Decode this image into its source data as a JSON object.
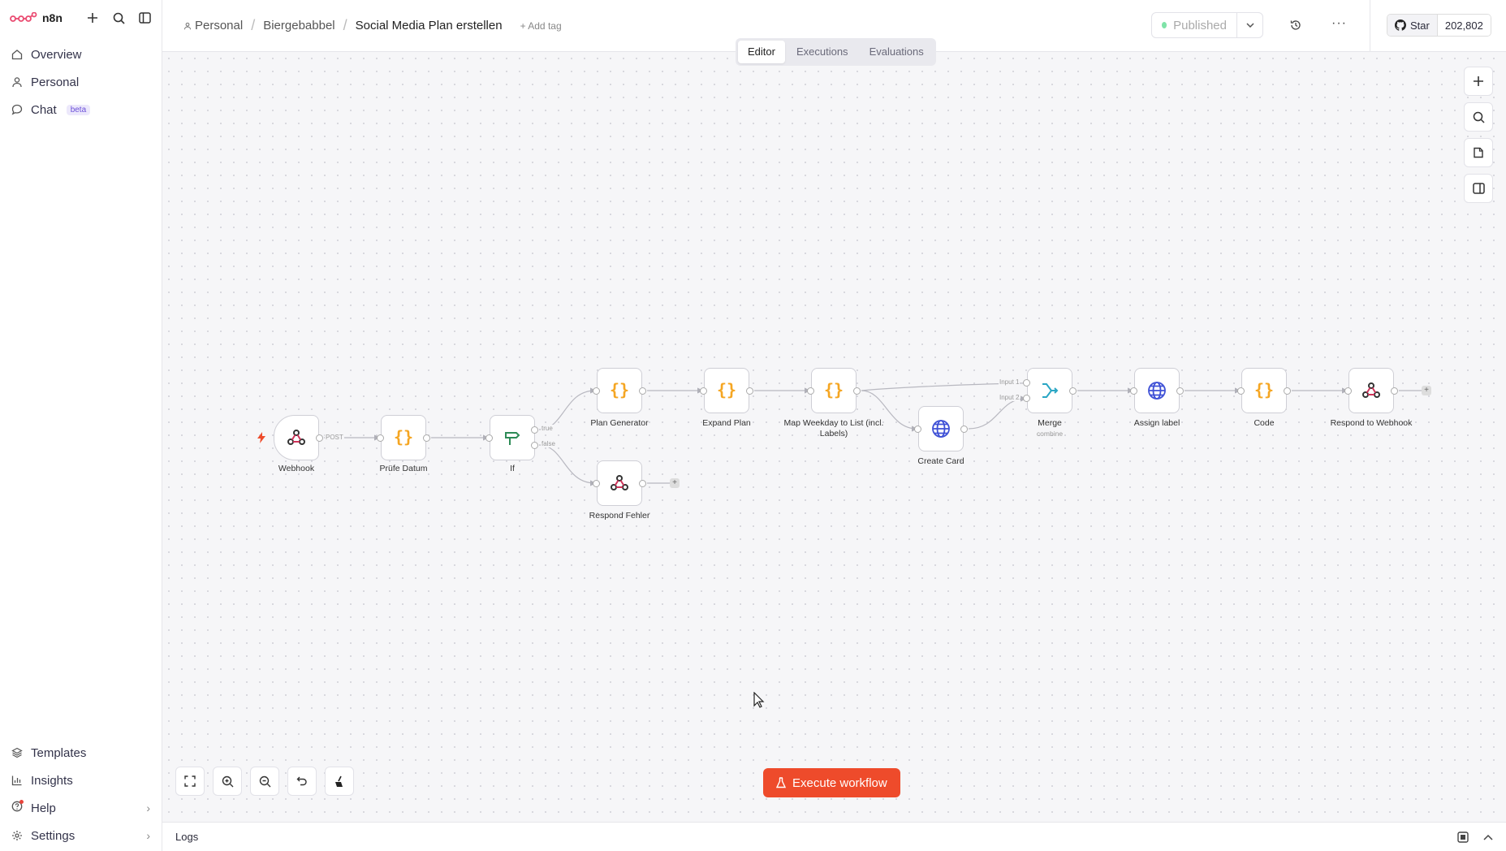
{
  "app": {
    "logo_text": "n8n"
  },
  "sidebar": {
    "items": [
      {
        "label": "Overview",
        "icon": "home-icon"
      },
      {
        "label": "Personal",
        "icon": "user-icon"
      },
      {
        "label": "Chat",
        "icon": "chat-icon",
        "badge": "beta"
      }
    ],
    "bottom_items": [
      {
        "label": "Templates",
        "icon": "templates-icon"
      },
      {
        "label": "Insights",
        "icon": "insights-icon"
      },
      {
        "label": "Help",
        "icon": "help-icon",
        "has_chevron": true
      },
      {
        "label": "Settings",
        "icon": "gear-icon",
        "has_chevron": true
      }
    ]
  },
  "header": {
    "breadcrumbs": [
      "Personal",
      "Biergebabbel",
      "Social Media Plan erstellen"
    ],
    "add_tag": "+ Add tag",
    "status": "Published",
    "github_star": "Star",
    "github_count": "202,802"
  },
  "tabs": [
    {
      "label": "Editor",
      "active": true
    },
    {
      "label": "Executions",
      "active": false
    },
    {
      "label": "Evaluations",
      "active": false
    }
  ],
  "workflow": {
    "nodes": [
      {
        "id": "webhook",
        "label": "Webhook",
        "icon": "webhook-icon"
      },
      {
        "id": "pruefe",
        "label": "Prüfe Datum",
        "icon": "code-braces-icon"
      },
      {
        "id": "if",
        "label": "If",
        "icon": "if-signpost-icon"
      },
      {
        "id": "plan",
        "label": "Plan Generator",
        "icon": "code-braces-icon"
      },
      {
        "id": "expand",
        "label": "Expand Plan",
        "icon": "code-braces-icon"
      },
      {
        "id": "mapweek",
        "label": "Map Weekday to List (incl. Labels)",
        "icon": "code-braces-icon"
      },
      {
        "id": "createcard",
        "label": "Create Card",
        "icon": "globe-icon"
      },
      {
        "id": "merge",
        "label": "Merge",
        "sublabel": "combine",
        "icon": "merge-icon"
      },
      {
        "id": "assign",
        "label": "Assign label",
        "icon": "globe-icon"
      },
      {
        "id": "code",
        "label": "Code",
        "icon": "code-braces-icon"
      },
      {
        "id": "respond",
        "label": "Respond to Webhook",
        "icon": "webhook-icon"
      },
      {
        "id": "respondfehler",
        "label": "Respond Fehler",
        "icon": "webhook-icon"
      }
    ],
    "edge_labels": {
      "post": "POST",
      "true": "true",
      "false": "false",
      "input1": "Input 1",
      "input2": "Input 2"
    }
  },
  "canvas": {
    "execute_button": "Execute workflow"
  },
  "logs": {
    "label": "Logs"
  },
  "colors": {
    "accent": "#ee4b2b",
    "code_orange": "#f5a623",
    "globe_blue": "#3f51d6",
    "merge_teal": "#2aa6c4",
    "if_green": "#2e8b57"
  }
}
